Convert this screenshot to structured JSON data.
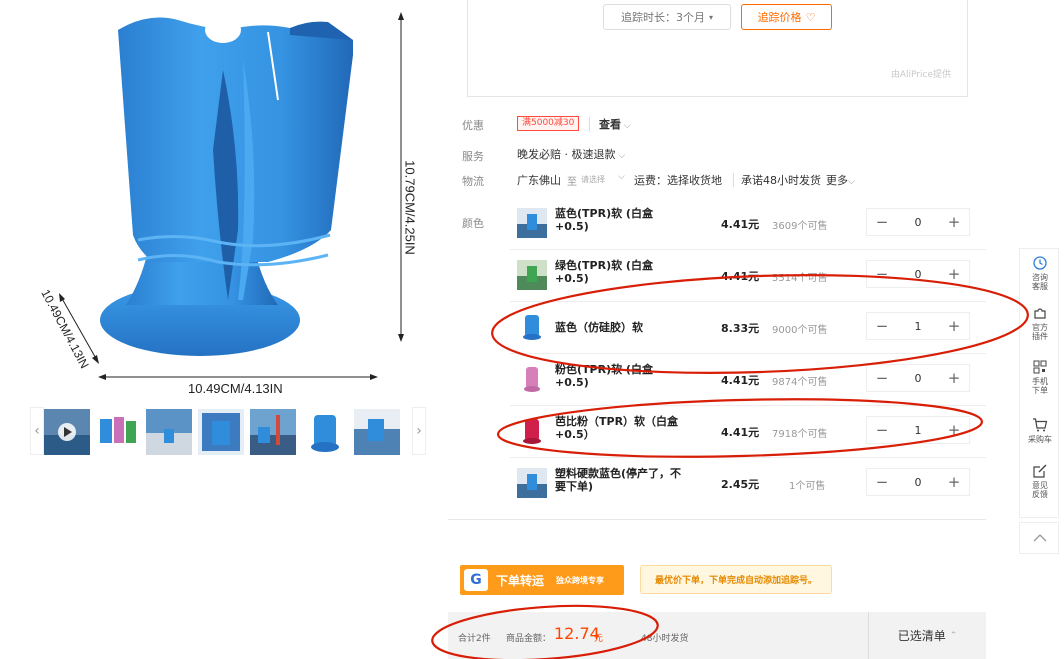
{
  "gallery": {
    "dim_height": "10.79CM/4.25IN",
    "dim_diag": "10.49CM/4.13IN",
    "dim_width": "10.49CM/4.13IN",
    "prev_arrow": "‹",
    "next_arrow": "›"
  },
  "price_chart": {
    "track_duration": "追踪时长：3个月",
    "track_button": "追踪价格",
    "provider": "由AliPrice提供"
  },
  "promo": {
    "label": "优惠",
    "tag": "满5000减30",
    "view": "查看"
  },
  "service": {
    "label": "服务",
    "text": "晚发必赔 · 极速退款"
  },
  "logistics": {
    "label": "物流",
    "origin": "广东佛山",
    "to": "至",
    "select": "请选择",
    "fee": "运费：选择收货地",
    "promise": "承诺48小时发货",
    "more": "更多"
  },
  "color_label": "颜色",
  "skus": [
    {
      "name": "蓝色(TPR)软 (白盒+0.5)",
      "price": "4.41元",
      "stock": "3609个可售",
      "qty": "0"
    },
    {
      "name": "绿色(TPR)软 (白盒+0.5)",
      "price": "4.41元",
      "stock": "5514个可售",
      "qty": "0"
    },
    {
      "name": "蓝色（仿硅胶）软",
      "price": "8.33元",
      "stock": "9000个可售",
      "qty": "1"
    },
    {
      "name": "粉色(TPR)软 (白盒+0.5)",
      "price": "4.41元",
      "stock": "9874个可售",
      "qty": "0"
    },
    {
      "name": "芭比粉（TPR）软（白盒+0.5）",
      "price": "4.41元",
      "stock": "7918个可售",
      "qty": "1"
    },
    {
      "name": "塑料硬款蓝色(停产了，不要下单)",
      "price": "2.45元",
      "stock": "1个可售",
      "qty": "0"
    }
  ],
  "stepper": {
    "minus": "−",
    "plus": "+"
  },
  "shipping": {
    "logo": "G",
    "title": "下单转运",
    "subtitle": "独众跨境专享",
    "tip": "最优价下单，下单完成自动添加追踪号。"
  },
  "summary": {
    "count": "合计2件",
    "amount_label": "商品金额：",
    "amount": "12.74",
    "unit": "元",
    "ship": "48小时发货",
    "list": "已选清单"
  },
  "toolbar": [
    {
      "icon": "clock-icon",
      "label": "咨询客服"
    },
    {
      "icon": "puzzle-icon",
      "label": "官方插件"
    },
    {
      "icon": "qrcode-icon",
      "label": "手机下单"
    },
    {
      "icon": "cart-icon",
      "label": "采购车"
    },
    {
      "icon": "edit-icon",
      "label": "意见反馈"
    },
    {
      "icon": "chevron-up-icon",
      "label": ""
    }
  ],
  "colors": {
    "accent": "#ff6a00",
    "price_red": "#ff4400",
    "annotation_red": "#d81e06",
    "product_blue": "#2f8ddc"
  }
}
